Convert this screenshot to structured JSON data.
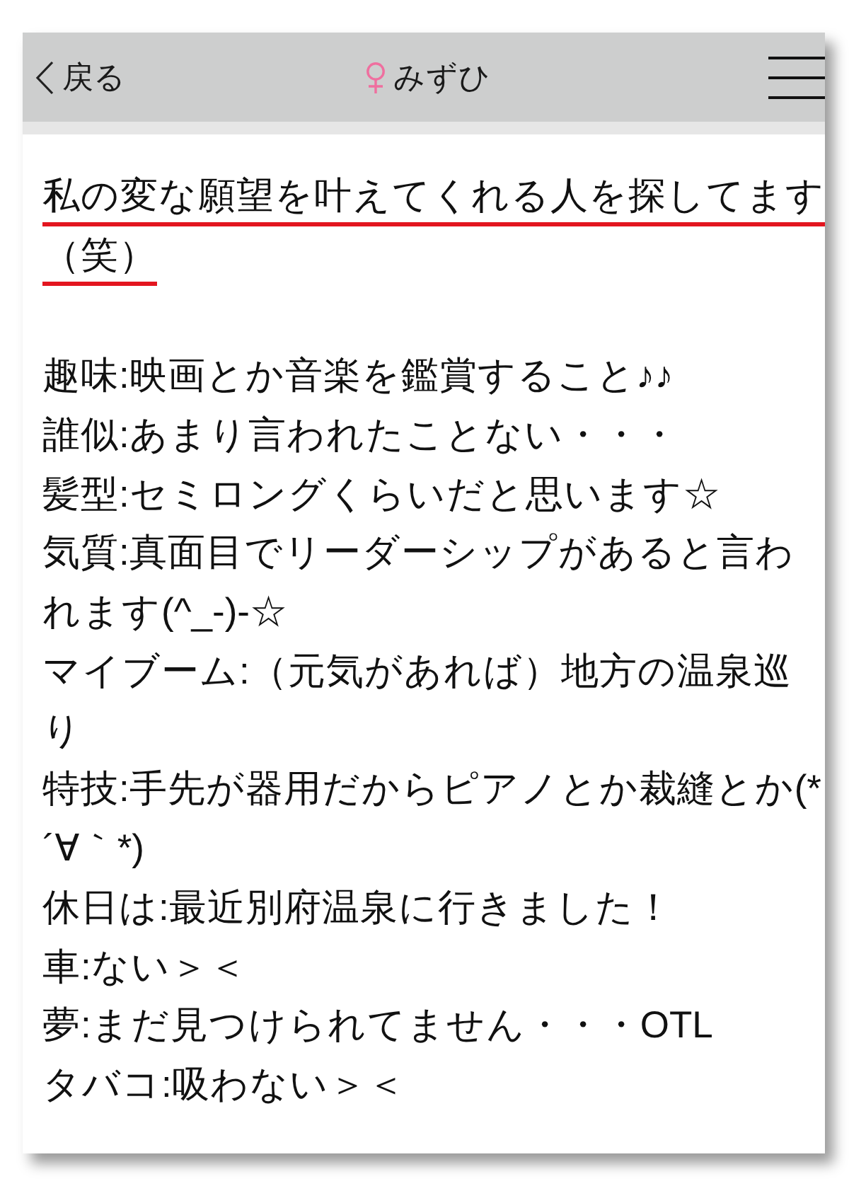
{
  "header": {
    "back_label": "戻る",
    "title": "みずひ"
  },
  "intro": {
    "text": "私の変な願望を叶えてくれる人を探してます（笑）",
    "underlined": true
  },
  "profile_lines": [
    "趣味:映画とか音楽を鑑賞すること♪♪",
    "誰似:あまり言われたことない・・・",
    "髪型:セミロングくらいだと思います☆",
    "気質:真面目でリーダーシップがあると言われます(^_-)-☆",
    "マイブーム:（元気があれば）地方の温泉巡り",
    "特技:手先が器用だからピアノとか裁縫とか(*´∀｀*)",
    "休日は:最近別府温泉に行きました！",
    "車:ない＞＜",
    "夢:まだ見つけられてません・・・OTL",
    "タバコ:吸わない＞＜"
  ]
}
